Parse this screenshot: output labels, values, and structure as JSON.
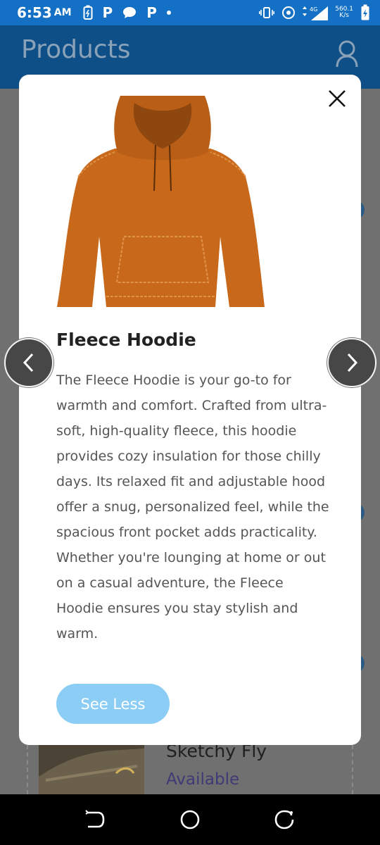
{
  "status_bar": {
    "time": "6:53",
    "ampm": "AM",
    "app_icon_letter": "P",
    "network_speed_value": "560.1",
    "network_speed_unit": "K/s",
    "network_type": "4G"
  },
  "app_bar": {
    "title": "Products",
    "profile_icon": "user-icon"
  },
  "modal": {
    "product_name": "Fleece Hoodie",
    "product_image": {
      "icon": "hoodie-image",
      "color": "#c8681b"
    },
    "description": "The Fleece Hoodie is your go-to for warmth and comfort. Crafted from ultra-soft, high-quality fleece, this hoodie provides cozy insulation for those chilly days. Its relaxed fit and adjustable hood offer a snug, personalized feel, while the spacious front pocket adds practicality. Whether you're lounging at home or out on a casual adventure, the Fleece Hoodie ensures you stay stylish and warm.",
    "toggle_label": "See Less",
    "close_icon": "close-icon"
  },
  "carousel": {
    "prev_icon": "chevron-left-icon",
    "next_icon": "chevron-right-icon"
  },
  "background_list": {
    "item_name": "Sketchy Fly",
    "item_status": "Available"
  },
  "nav_bar": {
    "back_icon": "back-icon",
    "home_icon": "home-icon",
    "recents_icon": "recents-icon"
  },
  "colors": {
    "primary": "#1470c4",
    "button": "#8ccdf6",
    "arrow_bg": "#474747"
  }
}
